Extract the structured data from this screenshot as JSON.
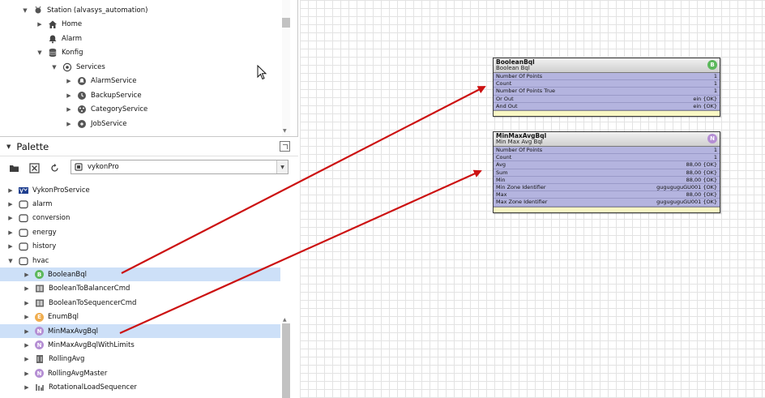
{
  "nav_tree": {
    "items": [
      {
        "label": "Station (alvasys_automation)",
        "twisty": "down",
        "icon": "station-icon",
        "level": 0
      },
      {
        "label": "Home",
        "twisty": "right",
        "icon": "home-icon",
        "level": 1
      },
      {
        "label": "Alarm",
        "twisty": "",
        "icon": "bell-icon",
        "level": 1
      },
      {
        "label": "Konfig",
        "twisty": "down",
        "icon": "database-icon",
        "level": 1
      },
      {
        "label": "Services",
        "twisty": "down",
        "icon": "services-icon",
        "level": 2
      },
      {
        "label": "AlarmService",
        "twisty": "right",
        "icon": "alarm-service-icon",
        "level": 3
      },
      {
        "label": "BackupService",
        "twisty": "right",
        "icon": "backup-service-icon",
        "level": 3
      },
      {
        "label": "CategoryService",
        "twisty": "right",
        "icon": "category-service-icon",
        "level": 3
      },
      {
        "label": "JobService",
        "twisty": "right",
        "icon": "job-service-icon",
        "level": 3
      }
    ]
  },
  "palette": {
    "title": "Palette",
    "module": "vykonPro",
    "items": [
      {
        "label": "VykonProService",
        "twisty": "right",
        "icon": "vykon-logo-icon",
        "selected": false
      },
      {
        "label": "alarm",
        "twisty": "right",
        "icon": "folder-icon",
        "selected": false
      },
      {
        "label": "conversion",
        "twisty": "right",
        "icon": "folder-icon",
        "selected": false
      },
      {
        "label": "energy",
        "twisty": "right",
        "icon": "folder-icon",
        "selected": false
      },
      {
        "label": "history",
        "twisty": "right",
        "icon": "folder-icon",
        "selected": false
      },
      {
        "label": "hvac",
        "twisty": "down",
        "icon": "folder-icon",
        "selected": false
      },
      {
        "label": "BooleanBql",
        "twisty": "right",
        "icon": "boolean-b-icon",
        "badge": "B",
        "badge_color": "#5cb85c",
        "selected": true
      },
      {
        "label": "BooleanToBalancerCmd",
        "twisty": "right",
        "icon": "component-icon",
        "selected": false
      },
      {
        "label": "BooleanToSequencerCmd",
        "twisty": "right",
        "icon": "component-icon",
        "selected": false
      },
      {
        "label": "EnumBql",
        "twisty": "right",
        "icon": "enum-e-icon",
        "badge": "E",
        "badge_color": "#f0ad4e",
        "selected": false
      },
      {
        "label": "MinMaxAvgBql",
        "twisty": "right",
        "icon": "numeric-n-icon",
        "badge": "N",
        "badge_color": "#b58fd4",
        "selected": true
      },
      {
        "label": "MinMaxAvgBqlWithLimits",
        "twisty": "right",
        "icon": "numeric-n-icon",
        "badge": "N",
        "badge_color": "#b58fd4",
        "selected": false
      },
      {
        "label": "RollingAvg",
        "twisty": "right",
        "icon": "rolling-avg-icon",
        "selected": false
      },
      {
        "label": "RollingAvgMaster",
        "twisty": "right",
        "icon": "numeric-n-icon",
        "badge": "N",
        "badge_color": "#b58fd4",
        "selected": false
      },
      {
        "label": "RotationalLoadSequencer",
        "twisty": "right",
        "icon": "sequencer-icon",
        "selected": false
      }
    ]
  },
  "components": [
    {
      "title": "BooleanBql",
      "type": "Boolean Bql",
      "badge": "B",
      "badge_color": "#5cb85c",
      "slots": [
        {
          "name": "Number Of Points",
          "value": "1"
        },
        {
          "name": "Count",
          "value": "1"
        },
        {
          "name": "Number Of Points True",
          "value": "1"
        },
        {
          "name": "Or Out",
          "value": "ein {OK}"
        },
        {
          "name": "And Out",
          "value": "ein {OK}"
        }
      ]
    },
    {
      "title": "MinMaxAvgBql",
      "type": "Min Max Avg Bql",
      "badge": "N",
      "badge_color": "#b58fd4",
      "slots": [
        {
          "name": "Number Of Points",
          "value": "1"
        },
        {
          "name": "Count",
          "value": "1"
        },
        {
          "name": "Avg",
          "value": "88,00 {OK}"
        },
        {
          "name": "Sum",
          "value": "88,00 {OK}"
        },
        {
          "name": "Min",
          "value": "88,00 {OK}"
        },
        {
          "name": "Min Zone Identifier",
          "value": "guguguguGU001 {OK}"
        },
        {
          "name": "Max",
          "value": "88,00 {OK}"
        },
        {
          "name": "Max Zone Identifier",
          "value": "guguguguGU001 {OK}"
        }
      ]
    }
  ],
  "colors": {
    "selection": "#cde0f8",
    "component_body": "#b4b4df",
    "arrow": "#cc1111"
  }
}
